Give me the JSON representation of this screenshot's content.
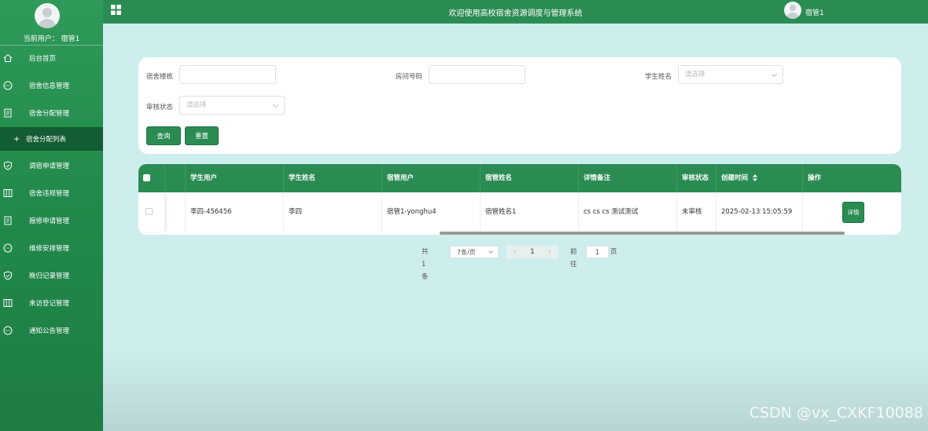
{
  "app": {
    "title": "欢迎使用高校宿舍资源调度与管理系统",
    "user_name": "宿管1"
  },
  "sidebar": {
    "current_user": "当前用户： 宿管1",
    "items": [
      {
        "label": "后台首页",
        "icon": "home-icon"
      },
      {
        "label": "宿舍信息管理",
        "icon": "chat-icon"
      },
      {
        "label": "宿舍分配管理",
        "icon": "document-icon"
      },
      {
        "label": "宿舍分配列表",
        "icon": "plus-icon",
        "active": true
      },
      {
        "label": "调宿申请管理",
        "icon": "shield-icon"
      },
      {
        "label": "宿舍违规管理",
        "icon": "columns-icon"
      },
      {
        "label": "报修申请管理",
        "icon": "document-icon"
      },
      {
        "label": "维修安排管理",
        "icon": "chat-icon"
      },
      {
        "label": "晚归记录管理",
        "icon": "shield-icon"
      },
      {
        "label": "来访登记管理",
        "icon": "columns-icon"
      },
      {
        "label": "通知公告管理",
        "icon": "chat-icon"
      }
    ]
  },
  "search": {
    "building_label": "宿舍楼栋",
    "building_value": "",
    "room_label": "房间号码",
    "room_value": "",
    "student_label": "学生姓名",
    "student_placeholder": "请选择",
    "status_label": "审核状态",
    "status_placeholder": "请选择",
    "query_button": "查询",
    "reset_button": "重置"
  },
  "table": {
    "columns": [
      "学生用户",
      "学生姓名",
      "宿管用户",
      "宿管姓名",
      "详情备注",
      "审核状态",
      "创建时间",
      "操作"
    ],
    "sort_icon": "sort-icon",
    "rows": [
      {
        "student_user": "李四-456456",
        "student_name": "李四",
        "manager_user": "宿管1-yonghu4",
        "manager_name": "宿管姓名1",
        "remark": "cs cs cs 测试测试",
        "status": "未审核",
        "created": "2025-02-13 15:05:59",
        "action": "详情"
      }
    ]
  },
  "pagination": {
    "total": "共 1 条",
    "page_size": "7条/页",
    "current_page": "1",
    "goto_label": "前往",
    "goto_value": "1",
    "page_suffix": "页"
  },
  "watermark": "CSDN @vx_CXKF10088",
  "colors": {
    "brand": "#2b8c53",
    "sidebar_active": "#145c31",
    "background": "#cdeeed"
  }
}
